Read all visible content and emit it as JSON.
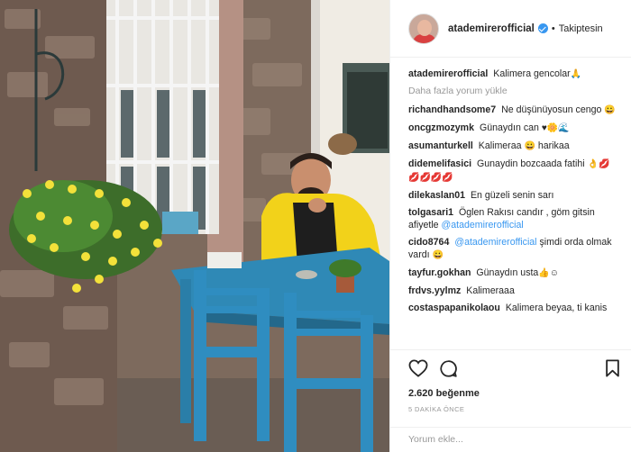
{
  "post": {
    "photo_alt": "",
    "header": {
      "username": "atademirerofficial",
      "separator": "•",
      "follow_status": "Takiptesin"
    },
    "caption": {
      "username": "atademirerofficial",
      "text": "Kalimera gencolar",
      "emoji": "🙏"
    },
    "load_more": "Daha fazla yorum yükle",
    "comments": [
      {
        "username": "richandhandsome7",
        "text": "Ne düşünüyosun cengo",
        "emoji": "😀"
      },
      {
        "username": "oncgzmozymk",
        "text": "Günaydın can",
        "emoji": "♥🌼🌊"
      },
      {
        "username": "asumanturkell",
        "text": "Kalimeraa",
        "emoji": "😀",
        "text2": "harikaa"
      },
      {
        "username": "didemelifasici",
        "text": "Gunaydin bozcaada fatihi",
        "emoji": "👌💋💋💋💋💋"
      },
      {
        "username": "dilekaslan01",
        "text": "En güzeli senin sarı"
      },
      {
        "username": "tolgasari1",
        "text": "Öglen Rakısı candır , göm gitsin afiyetle",
        "mention": "@atademirerofficial"
      },
      {
        "username": "cido8764",
        "mention": "@atademirerofficial",
        "text": "şimdi orda olmak vardı",
        "emoji": "😀"
      },
      {
        "username": "tayfur.gokhan",
        "text": "Günaydın usta",
        "emoji": "👍☺"
      },
      {
        "username": "frdvs.yylmz",
        "text": "Kalimeraaa"
      },
      {
        "username": "costaspapanikolaou",
        "text": "Kalimera beyaa, ti kanis"
      }
    ],
    "likes": "2.620 beğenme",
    "time_ago": "5 DAKİKA ÖNCE",
    "add_comment_placeholder": "Yorum ekle...",
    "colors": {
      "link": "#3897f0",
      "muted": "#999999",
      "text": "#262626",
      "verified": "#3897f0"
    },
    "icons": [
      "heart-icon",
      "comment-icon",
      "bookmark-icon",
      "verified-badge-icon"
    ]
  }
}
